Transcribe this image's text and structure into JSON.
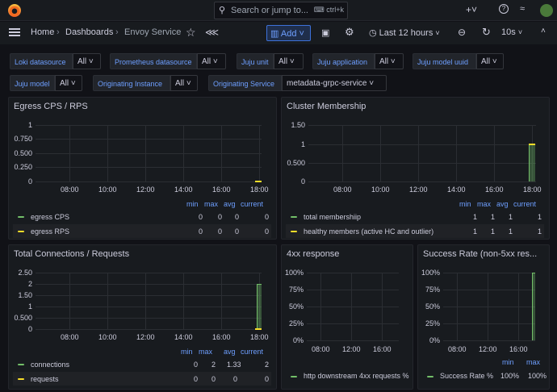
{
  "search": {
    "placeholder": "Search or jump to...",
    "shortcut": "ctrl+k"
  },
  "breadcrumb": {
    "home": "Home",
    "dashboards": "Dashboards",
    "current": "Envoy Service"
  },
  "toolbar": {
    "add_label": "Add",
    "time_range": "Last 12 hours",
    "refresh": "10s"
  },
  "variables": [
    {
      "label": "Loki datasource",
      "value": "All"
    },
    {
      "label": "Prometheus datasource",
      "value": "All"
    },
    {
      "label": "Juju unit",
      "value": "All"
    },
    {
      "label": "Juju application",
      "value": "All"
    },
    {
      "label": "Juju model uuid",
      "value": "All"
    },
    {
      "label": "Juju model",
      "value": "All"
    },
    {
      "label": "Originating Instance",
      "value": "All"
    },
    {
      "label": "Originating Service",
      "value": "metadata-grpc-service"
    }
  ],
  "colors": {
    "accent": "#6e9fff",
    "green": "#73bf69",
    "yellow": "#fade2a"
  },
  "panels": {
    "egress": {
      "title": "Egress CPS / RPS",
      "headers": {
        "min": "min",
        "max": "max",
        "avg": "avg",
        "current": "current"
      },
      "rows": [
        {
          "name": "egress CPS",
          "min": "0",
          "max": "0",
          "avg": "0",
          "current": "0"
        },
        {
          "name": "egress RPS",
          "min": "0",
          "max": "0",
          "avg": "0",
          "current": "0"
        }
      ]
    },
    "cluster": {
      "title": "Cluster Membership",
      "headers": {
        "min": "min",
        "max": "max",
        "avg": "avg",
        "current": "current"
      },
      "rows": [
        {
          "name": "total membershiip",
          "min": "1",
          "max": "1",
          "avg": "1",
          "current": "1"
        },
        {
          "name": "healthy members (active HC and outlier)",
          "min": "1",
          "max": "1",
          "avg": "1",
          "current": "1"
        }
      ]
    },
    "connections": {
      "title": "Total Connections / Requests",
      "headers": {
        "min": "min",
        "max": "max",
        "avg": "avg",
        "current": "current"
      },
      "rows": [
        {
          "name": "connections",
          "min": "0",
          "max": "2",
          "avg": "1.33",
          "current": "2"
        },
        {
          "name": "requests",
          "min": "0",
          "max": "0",
          "avg": "0",
          "current": "0"
        }
      ]
    },
    "4xx": {
      "title": "4xx response",
      "legend": "http downstream 4xx requests %"
    },
    "success": {
      "title": "Success Rate (non-5xx res...",
      "headers": {
        "min": "min",
        "max": "max"
      },
      "rows": [
        {
          "name": "Success Rate %",
          "min": "100%",
          "max": "100%"
        }
      ]
    }
  },
  "chart_data": [
    {
      "type": "line",
      "title": "Egress CPS / RPS",
      "x": [
        "08:00",
        "10:00",
        "12:00",
        "14:00",
        "16:00",
        "18:00"
      ],
      "yticks": [
        "1",
        "0.750",
        "0.500",
        "0.250",
        "0"
      ],
      "ylim": [
        0,
        1
      ],
      "series": [
        {
          "name": "egress CPS",
          "values": [
            0
          ]
        },
        {
          "name": "egress RPS",
          "values": [
            0
          ]
        }
      ]
    },
    {
      "type": "line",
      "title": "Cluster Membership",
      "x": [
        "08:00",
        "10:00",
        "12:00",
        "14:00",
        "16:00",
        "18:00"
      ],
      "yticks": [
        "1.50",
        "1",
        "0.500",
        "0"
      ],
      "ylim": [
        0,
        1.5
      ],
      "series": [
        {
          "name": "total membershiip",
          "values": [
            1
          ]
        },
        {
          "name": "healthy members (active HC and outlier)",
          "values": [
            1
          ]
        }
      ]
    },
    {
      "type": "line",
      "title": "Total Connections / Requests",
      "x": [
        "08:00",
        "10:00",
        "12:00",
        "14:00",
        "16:00",
        "18:00"
      ],
      "yticks": [
        "2.50",
        "2",
        "1.50",
        "1",
        "0.500",
        "0"
      ],
      "ylim": [
        0,
        2.5
      ],
      "series": [
        {
          "name": "connections",
          "values": [
            2
          ]
        },
        {
          "name": "requests",
          "values": [
            0
          ]
        }
      ]
    },
    {
      "type": "line",
      "title": "4xx response",
      "x": [
        "08:00",
        "12:00",
        "16:00"
      ],
      "yticks": [
        "100%",
        "75%",
        "50%",
        "25%",
        "0%"
      ],
      "ylim": [
        0,
        100
      ],
      "series": [
        {
          "name": "http downstream 4xx requests %",
          "values": []
        }
      ]
    },
    {
      "type": "line",
      "title": "Success Rate (non-5xx res...",
      "x": [
        "08:00",
        "12:00",
        "16:00"
      ],
      "yticks": [
        "100%",
        "75%",
        "50%",
        "25%",
        "0%"
      ],
      "ylim": [
        0,
        100
      ],
      "series": [
        {
          "name": "Success Rate %",
          "values": [
            100
          ]
        }
      ]
    }
  ]
}
